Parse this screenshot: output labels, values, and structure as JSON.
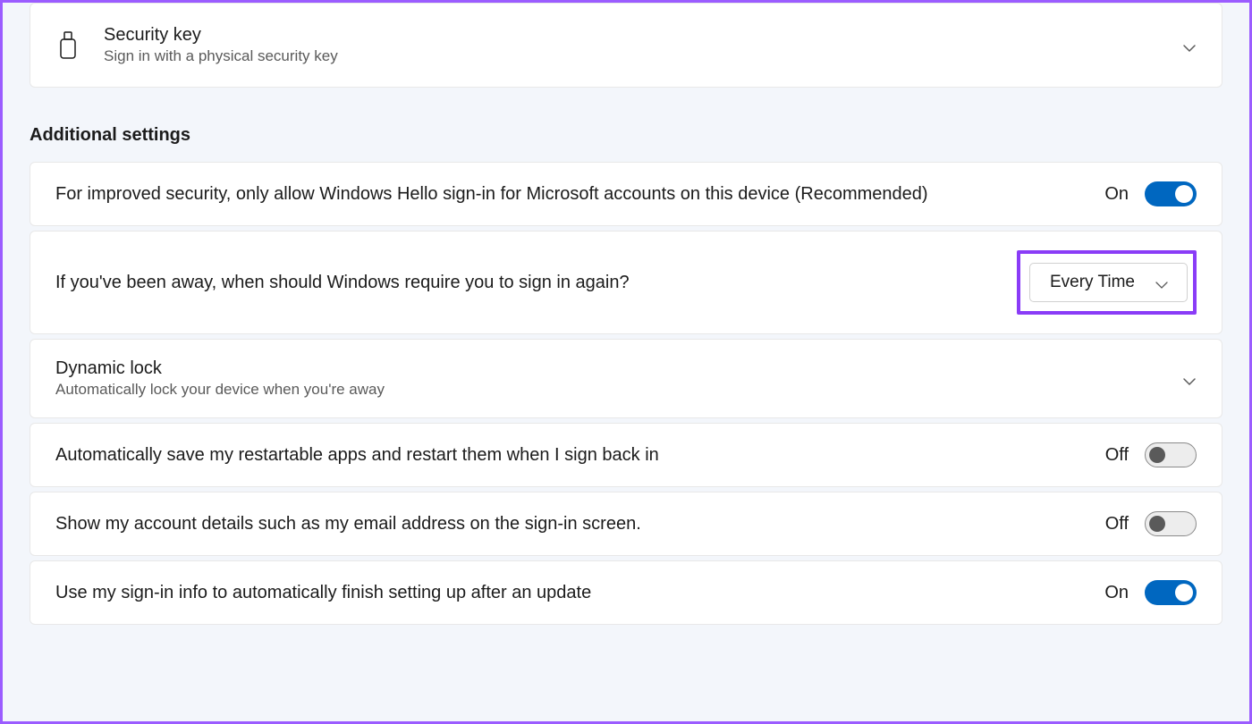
{
  "security_key": {
    "title": "Security key",
    "subtitle": "Sign in with a physical security key"
  },
  "section_header": "Additional settings",
  "settings": {
    "hello": {
      "text": "For improved security, only allow Windows Hello sign-in for Microsoft accounts on this device (Recommended)",
      "state_label": "On"
    },
    "require_signin": {
      "text": "If you've been away, when should Windows require you to sign in again?",
      "dropdown_value": "Every Time"
    },
    "dynamic_lock": {
      "title": "Dynamic lock",
      "subtitle": "Automatically lock your device when you're away"
    },
    "restartable_apps": {
      "text": "Automatically save my restartable apps and restart them when I sign back in",
      "state_label": "Off"
    },
    "account_details": {
      "text": "Show my account details such as my email address on the sign-in screen.",
      "state_label": "Off"
    },
    "signin_info_update": {
      "text": "Use my sign-in info to automatically finish setting up after an update",
      "state_label": "On"
    }
  }
}
